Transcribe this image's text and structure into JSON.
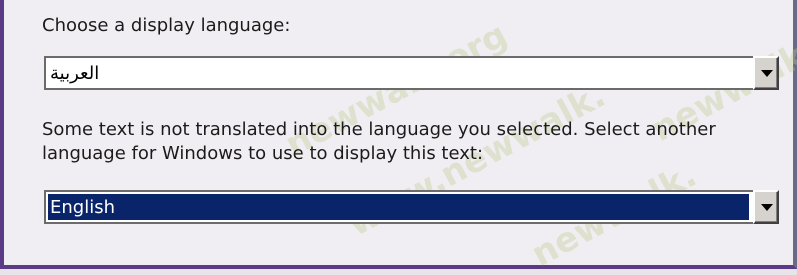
{
  "dialog": {
    "display_language_label": "Choose a display language:",
    "display_language_value": "العربية",
    "fallback_description": "Some text is not translated into the language you selected. Select another language for Windows to use to display this text:",
    "fallback_language_value": "English"
  },
  "watermark": {
    "text_1": "newwalk.org",
    "text_2": "www.newwalk.",
    "text_3": "newwalk.",
    "color": "#bec88c"
  },
  "colors": {
    "selection_bg": "#0a246a",
    "frame_border": "#5b3a86"
  },
  "icons": {
    "dropdown_arrow": "chevron-down-icon"
  }
}
